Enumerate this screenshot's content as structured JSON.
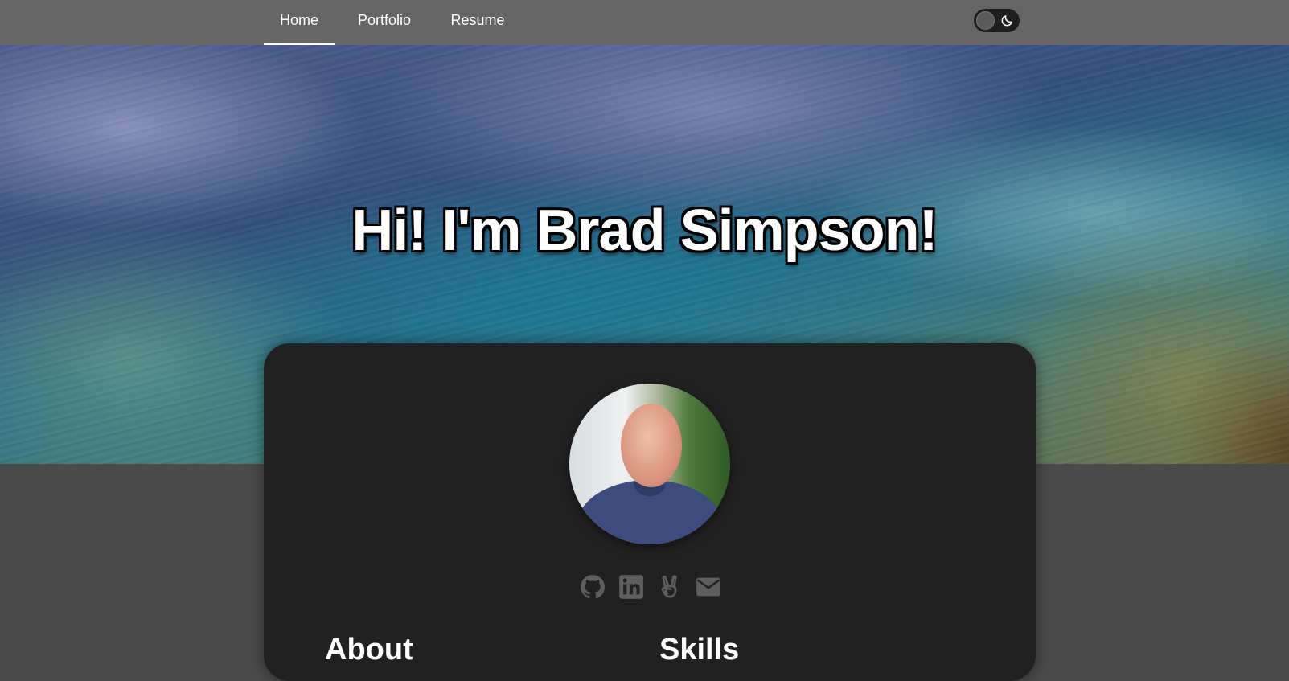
{
  "nav": {
    "items": [
      {
        "label": "Home",
        "active": true
      },
      {
        "label": "Portfolio",
        "active": false
      },
      {
        "label": "Resume",
        "active": false
      }
    ],
    "theme_toggle": {
      "state": "dark",
      "icon": "moon-icon"
    }
  },
  "hero": {
    "title": "Hi! I'm Brad Simpson!"
  },
  "profile": {
    "avatar": "profile-photo",
    "socials": [
      {
        "icon": "github-icon"
      },
      {
        "icon": "linkedin-icon"
      },
      {
        "icon": "angellist-icon"
      },
      {
        "icon": "envelope-icon"
      }
    ]
  },
  "sections": {
    "about_heading": "About",
    "skills_heading": "Skills"
  },
  "colors": {
    "navbar": "#656565",
    "page_background": "#4a4a4a",
    "card": "#212121",
    "icon": "#5e5e5e"
  }
}
